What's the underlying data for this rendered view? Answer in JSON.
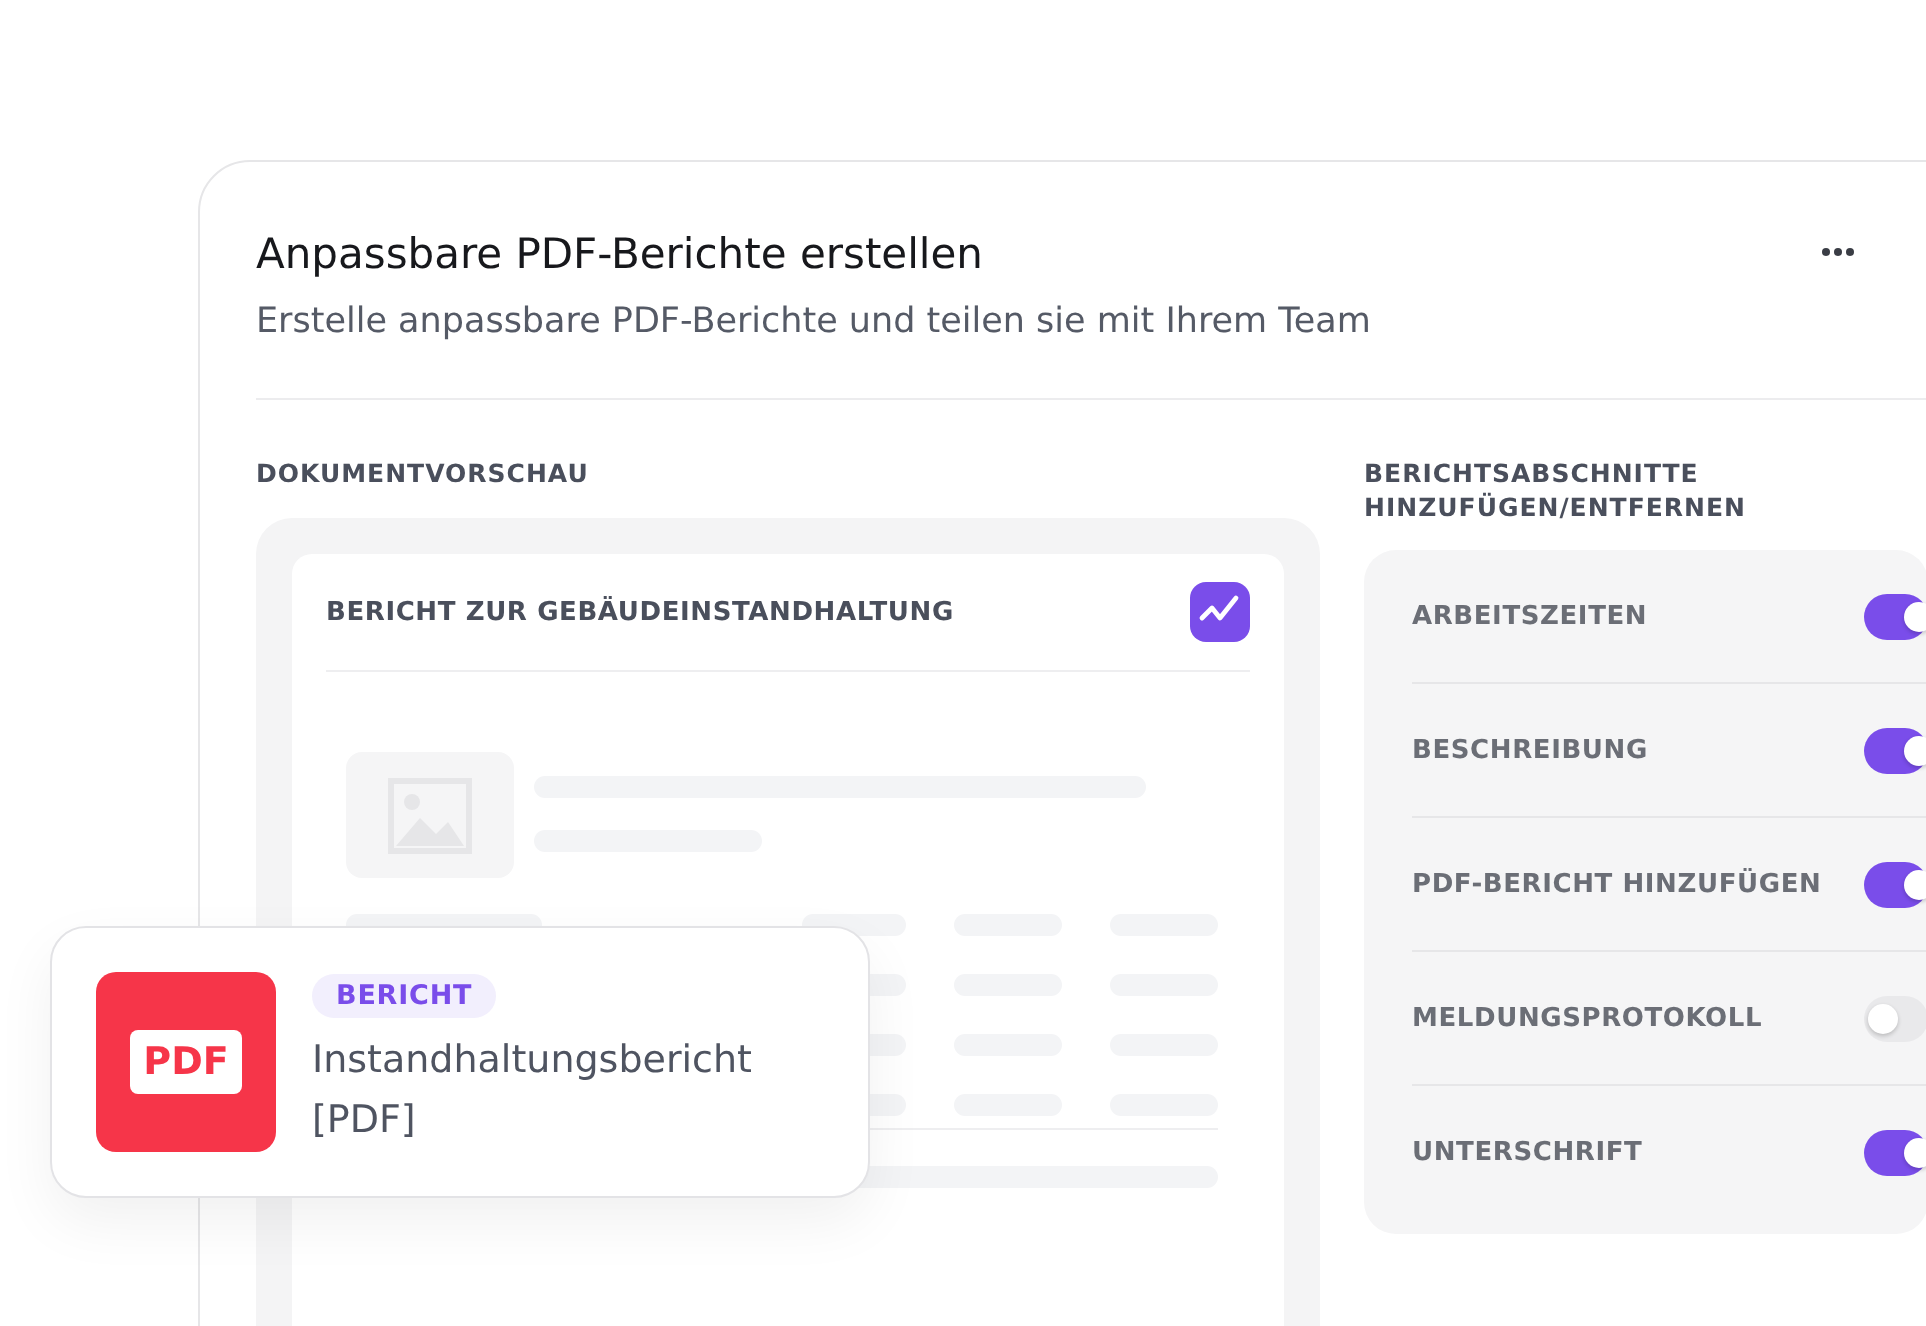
{
  "card": {
    "title": "Anpassbare PDF-Berichte erstellen",
    "subtitle": "Erstelle anpassbare PDF-Berichte und teilen sie mit Ihrem Team"
  },
  "preview": {
    "heading": "DOKUMENTVORSCHAU",
    "document_title": "BERICHT ZUR GEBÄUDEINSTANDHALTUNG"
  },
  "sections": {
    "heading": "BERICHTSABSCHNITTE HINZUFÜGEN/ENTFERNEN",
    "items": [
      {
        "label": "ARBEITSZEITEN",
        "on": true
      },
      {
        "label": "BESCHREIBUNG",
        "on": true
      },
      {
        "label": "PDF-BERICHT HINZUFÜGEN",
        "on": true
      },
      {
        "label": "MELDUNGSPROTOKOLL",
        "on": false
      },
      {
        "label": "UNTERSCHRIFT",
        "on": true
      }
    ]
  },
  "file_card": {
    "icon_label": "PDF",
    "tag": "BERICHT",
    "name": "Instandhaltungsbericht [PDF]"
  }
}
